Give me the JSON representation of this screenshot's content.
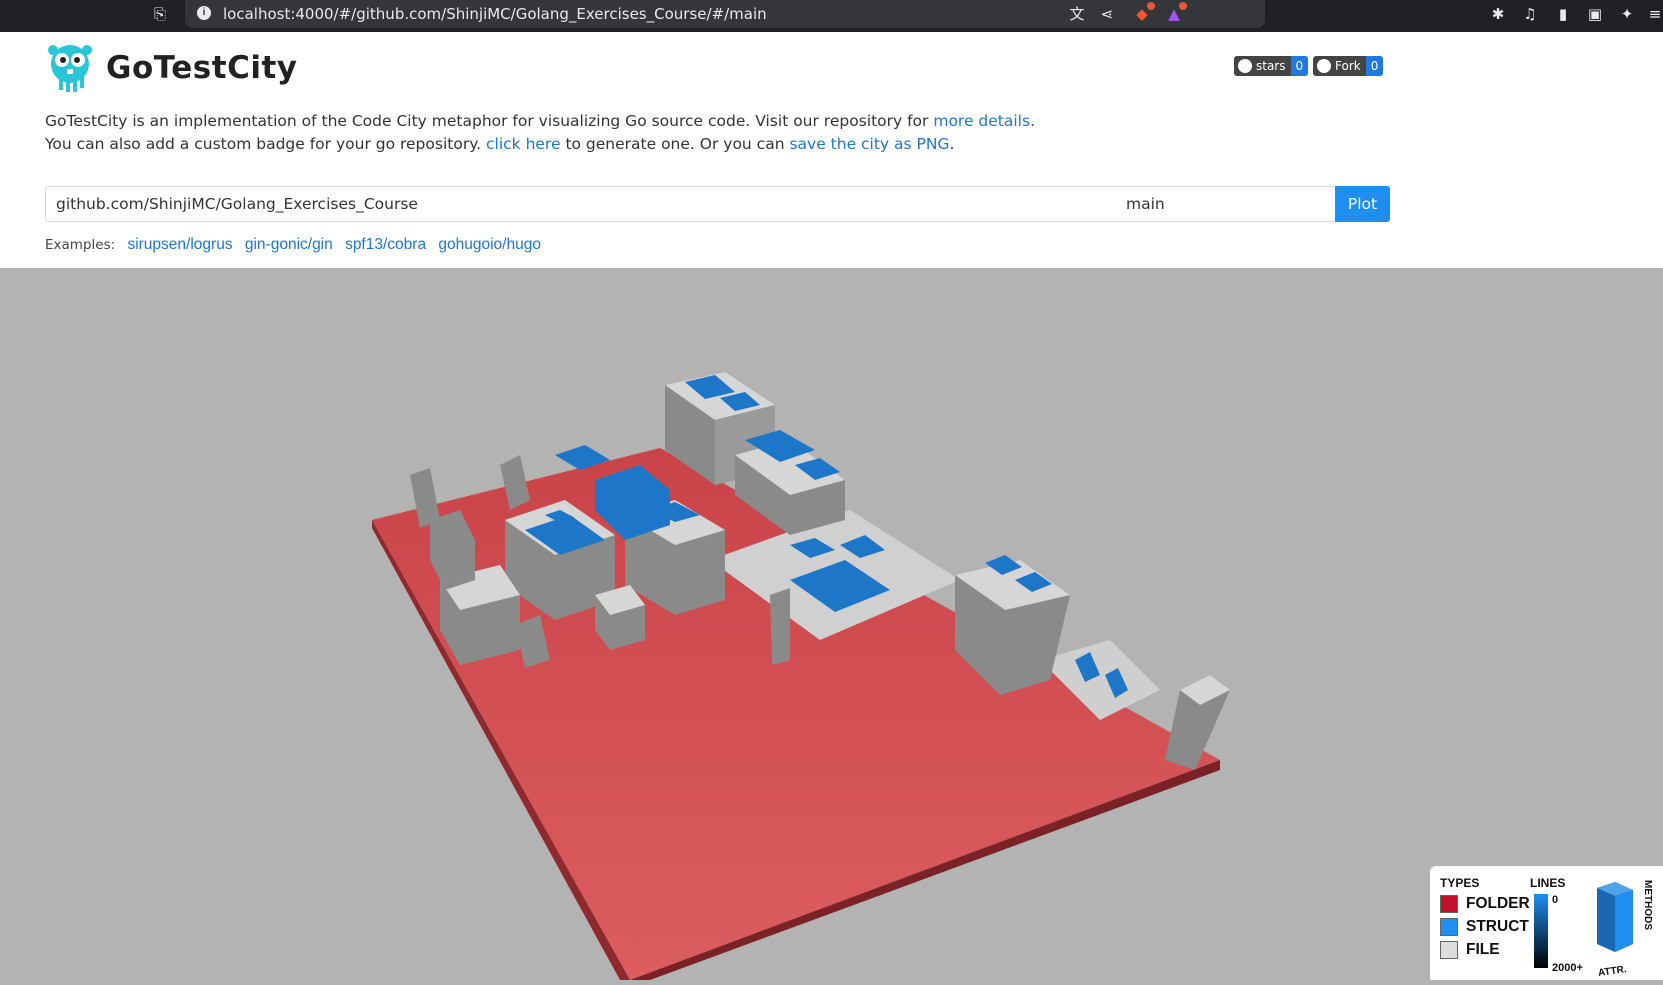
{
  "browser": {
    "url": "localhost:4000/#/github.com/ShinjiMC/Golang_Exercises_Course/#/main"
  },
  "header": {
    "brand": "GoTestCity",
    "stars_label": "stars",
    "stars_count": "0",
    "fork_label": "Fork",
    "fork_count": "0"
  },
  "description": {
    "line1_text": "GoTestCity is an implementation of the Code City metaphor for visualizing Go source code. Visit our repository for ",
    "line1_link": "more details",
    "line1_end": ".",
    "line2_text": "You can also add a custom badge for your go repository. ",
    "line2_link1": "click here",
    "line2_mid": " to generate one. Or you can ",
    "line2_link2": "save the city as PNG",
    "line2_end": "."
  },
  "form": {
    "repo_value": "github.com/ShinjiMC/Golang_Exercises_Course",
    "branch_value": "main",
    "plot_label": "Plot"
  },
  "examples": {
    "label": "Examples:",
    "items": [
      "sirupsen/logrus",
      "gin-gonic/gin",
      "spf13/cobra",
      "gohugoio/hugo"
    ]
  },
  "legend": {
    "types_title": "TYPES",
    "lines_title": "LINES",
    "types": [
      {
        "label": "FOLDER",
        "color": "#c0132a"
      },
      {
        "label": "STRUCT",
        "color": "#1e8ff0"
      },
      {
        "label": "FILE",
        "color": "#dcdcdc"
      }
    ],
    "lines_min": "0",
    "lines_max": "2000+",
    "methods_label": "METHODS",
    "attr_label": "ATTR."
  },
  "colors": {
    "folder": "#d24b4f",
    "file": "#c8c8c8",
    "struct": "#1e76c8",
    "scene_bg": "#b3b3b3"
  }
}
